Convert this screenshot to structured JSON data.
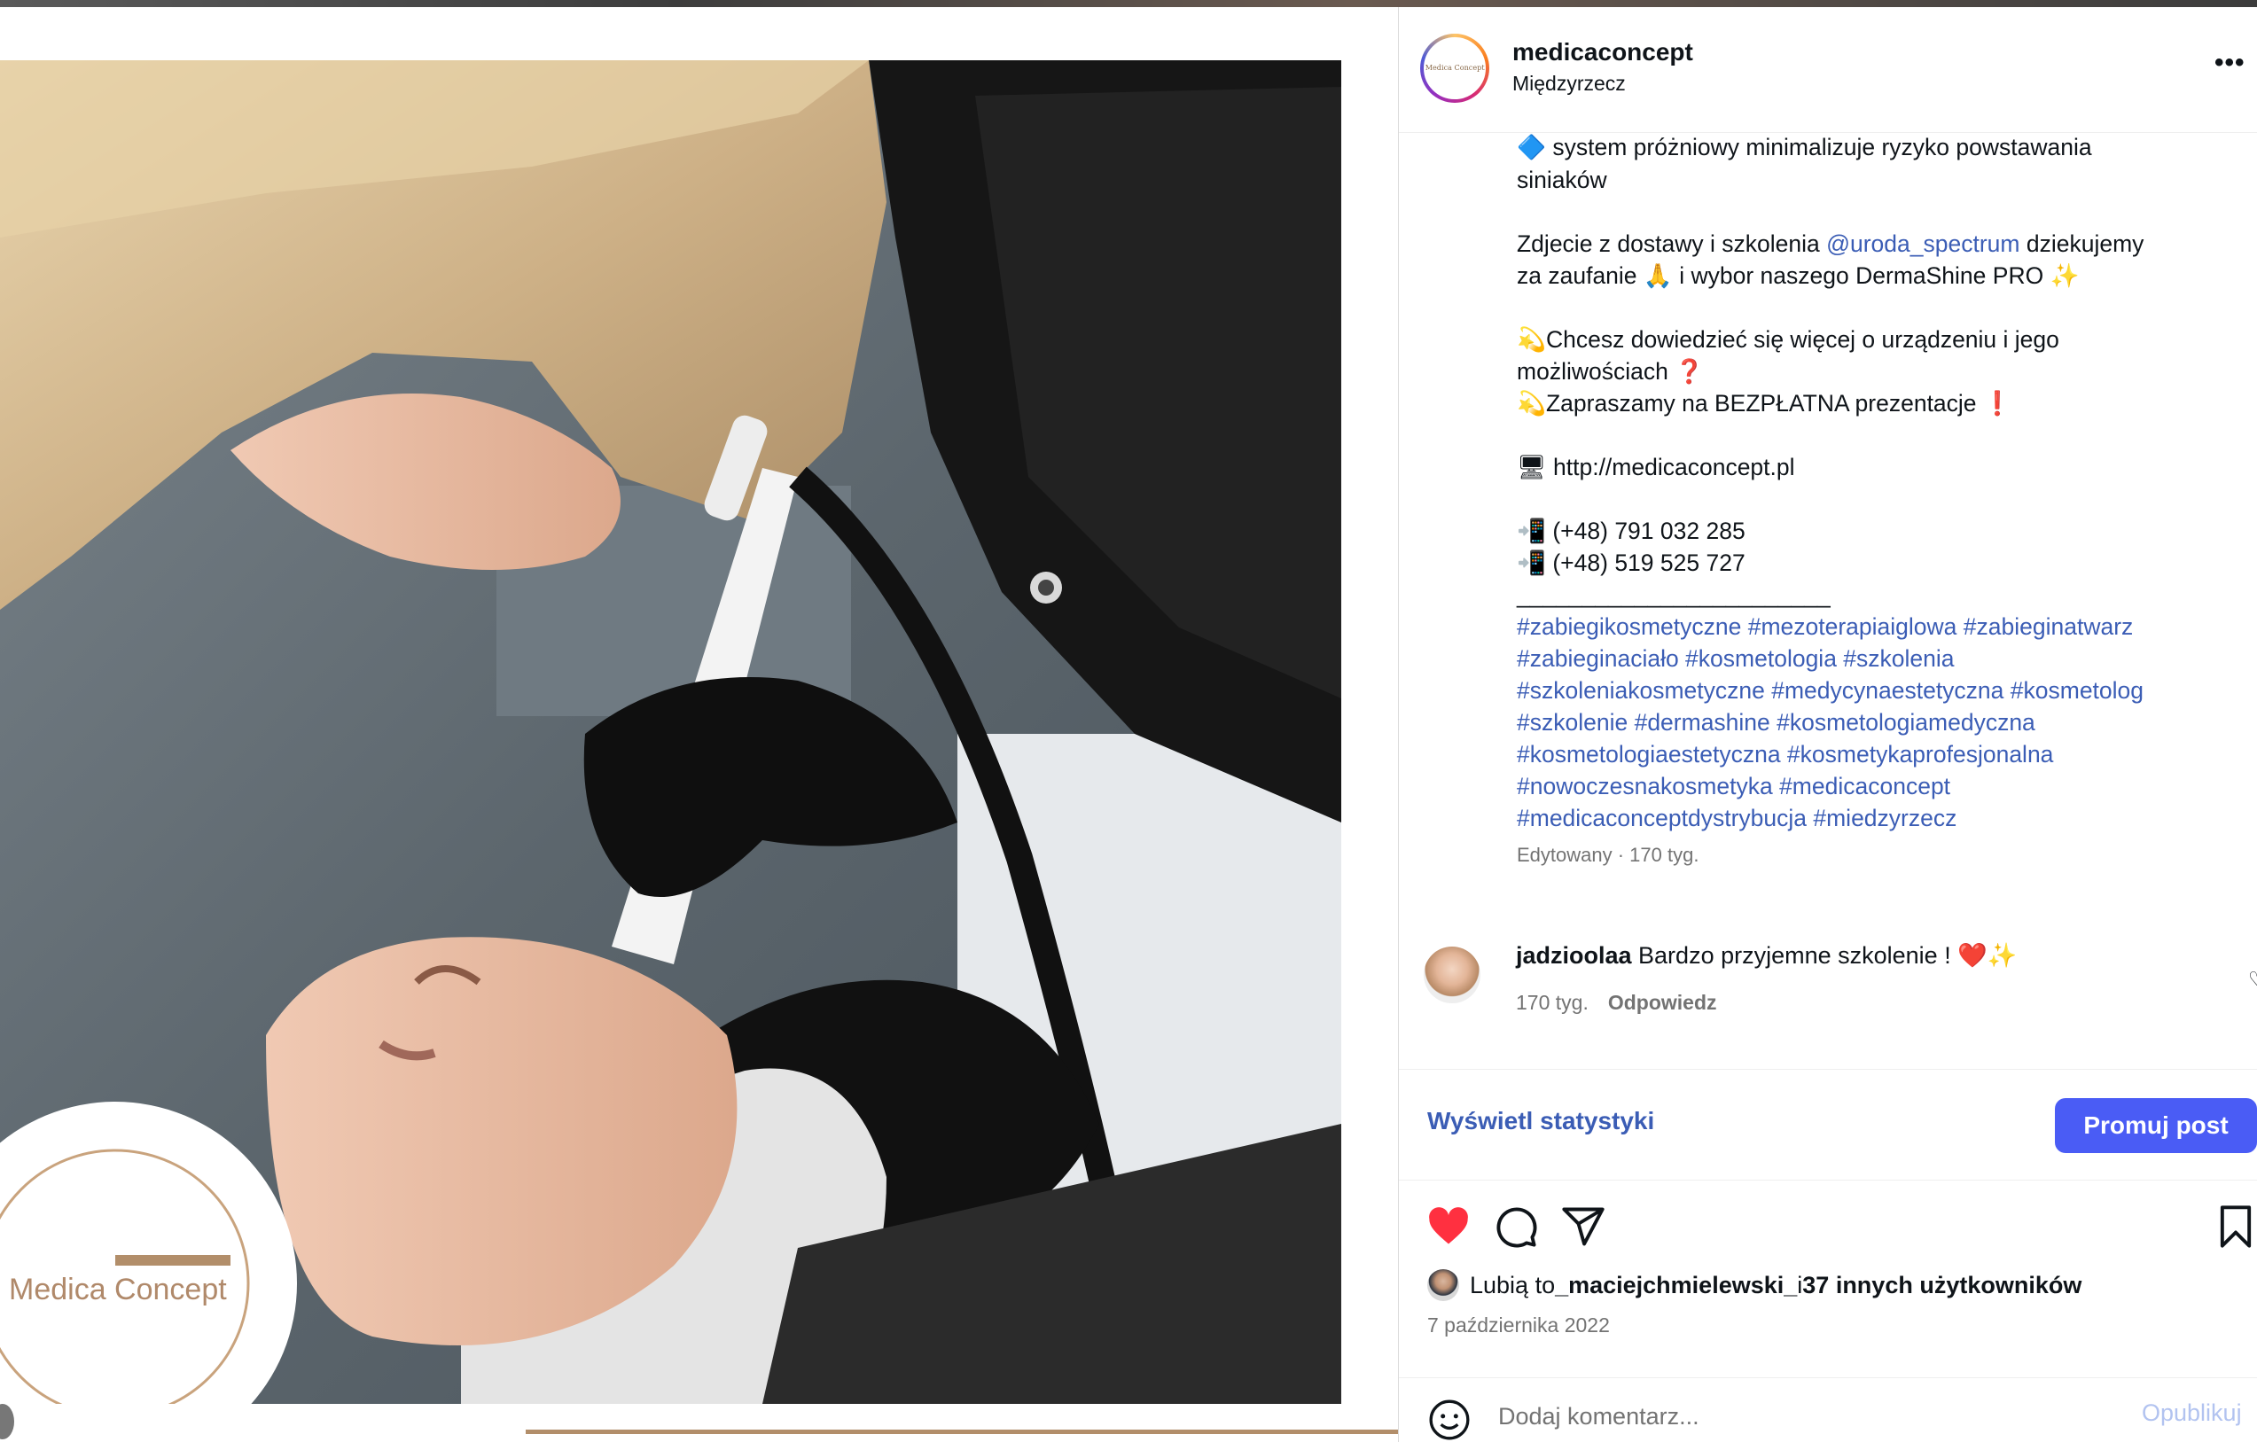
{
  "post": {
    "username": "medicaconcept",
    "location": "Międzyrzecz",
    "avatar_text": "Medica Concept",
    "photo_watermark": "Medica Concept",
    "device_label": "DermaShine PRO"
  },
  "caption": {
    "l1": "system próżniowy minimalizuje ryzyko powstawania",
    "l1_icon": "🔷",
    "l2": "siniaków",
    "l3a": "Zdjecie z dostawy i szkolenia ",
    "l3_mention": "@uroda_spectrum",
    "l3b": " dziekujemy",
    "l4": "za zaufanie 🙏 i wybor naszego DermaShine PRO ✨",
    "l5": "💫Chcesz dowiedzieć się więcej o urządzeniu i jego",
    "l6": "możliwościach ❓",
    "l7": "💫Zapraszamy na BEZPŁATNA prezentacje ❗",
    "l8": "🖥 http://medicaconcept.pl",
    "l9": "📲 (+48) 791 032 285",
    "l10": "📲 (+48) 519 525 727",
    "divider": "________________________",
    "h1": "#zabiegikosmetyczne #mezoterapiaiglowa #zabieginatwarz",
    "h2": "#zabieginaciało #kosmetologia #szkolenia",
    "h3": "#szkoleniakosmetyczne #medycynaestetyczna #kosmetolog",
    "h4": "#szkolenie #dermashine #kosmetologiamedyczna",
    "h5": "#kosmetologiaestetyczna #kosmetykaprofesjonalna",
    "h6": "#nowoczesnakosmetyka #medicaconcept",
    "h7": "#medicaconceptdystrybucja #miedzyrzecz",
    "edited": "Edytowany · 170 tyg."
  },
  "comment": {
    "user": "jadzioolaa",
    "text": " Bardzo przyjemne szkolenie ! ❤️✨",
    "age": "170 tyg.",
    "reply": "Odpowiedz"
  },
  "stats": {
    "view_label": "Wyświetl statystyki",
    "promote_label": "Promuj post"
  },
  "likes": {
    "prefix": "Lubią to ",
    "user": "_maciejchmielewski_",
    "middle": " i ",
    "others": "37 innych użytkowników",
    "date": "7 października 2022"
  },
  "add_comment": {
    "placeholder": "Dodaj komentarz...",
    "publish_label": "Opublikuj"
  },
  "colors": {
    "link": "#3b5db5",
    "promote_bg": "#4a5cf5",
    "heart": "#ff3040",
    "brand_gold": "#b28e6a"
  },
  "icons": [
    "more-icon",
    "heart-icon",
    "comment-icon",
    "share-icon",
    "bookmark-icon",
    "emoji-icon",
    "like-comment-icon"
  ]
}
